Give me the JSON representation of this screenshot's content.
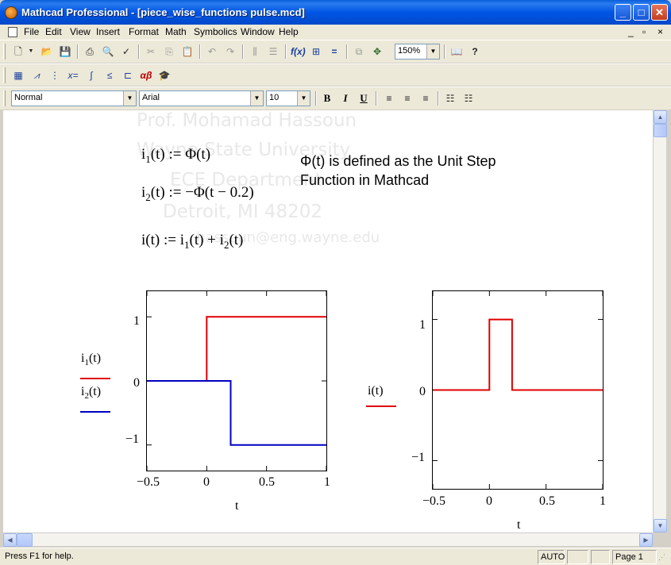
{
  "window": {
    "title": "Mathcad Professional - [piece_wise_functions pulse.mcd]",
    "controls": {
      "minimize": "_",
      "maximize": "□",
      "close": "✕"
    }
  },
  "menu": {
    "items": [
      "File",
      "Edit",
      "View",
      "Insert",
      "Format",
      "Math",
      "Symbolics",
      "Window",
      "Help"
    ],
    "doc_controls": [
      "_",
      "▫",
      "×"
    ]
  },
  "toolbar": {
    "zoom": "150%",
    "style": "Normal",
    "font": "Arial",
    "size": "10",
    "bold": "B",
    "italic": "I",
    "underline": "U"
  },
  "worksheet": {
    "watermark": [
      "Prof. Mohamad Hassoun",
      "Wayne State University",
      "ECE Department",
      "Detroit, MI 48202",
      "hassoun@eng.wayne.edu"
    ],
    "equations": {
      "eq1_lhs": "i",
      "eq1_sub": "1",
      "eq1_rhs": "(t) := Φ(t)",
      "eq2_lhs": "i",
      "eq2_sub": "2",
      "eq2_rhs": "(t) := −Φ(t − 0.2)",
      "eq3_a": "i(t) := i",
      "eq3_sub1": "1",
      "eq3_b": "(t) + i",
      "eq3_sub2": "2",
      "eq3_c": "(t)"
    },
    "note": {
      "line1": "Φ(t) is defined as the Unit Step",
      "line2": "Function in Mathcad"
    }
  },
  "chart_data": [
    {
      "type": "line",
      "xlabel": "t",
      "xlim": [
        -0.5,
        1
      ],
      "ylim": [
        -1.4,
        1.4
      ],
      "xticks": [
        "−0.5",
        "0",
        "0.5",
        "1"
      ],
      "yticks": [
        "1",
        "0",
        "−1"
      ],
      "legend": [
        {
          "name_base": "i",
          "name_sub": "1",
          "name_tail": "(t)"
        },
        {
          "name_base": "i",
          "name_sub": "2",
          "name_tail": "(t)"
        }
      ],
      "series": [
        {
          "color": "#e00000",
          "x": [
            -0.5,
            0,
            0,
            1
          ],
          "y": [
            0,
            0,
            1,
            1
          ]
        },
        {
          "color": "#0000c0",
          "x": [
            -0.5,
            0.2,
            0.2,
            1
          ],
          "y": [
            0,
            0,
            -1,
            -1
          ]
        }
      ]
    },
    {
      "type": "line",
      "xlabel": "t",
      "xlim": [
        -0.5,
        1
      ],
      "ylim": [
        -1.4,
        1.4
      ],
      "xticks": [
        "−0.5",
        "0",
        "0.5",
        "1"
      ],
      "yticks": [
        "1",
        "0",
        "−1"
      ],
      "legend": [
        {
          "name": "i(t)"
        }
      ],
      "series": [
        {
          "color": "#e00000",
          "x": [
            -0.5,
            0,
            0,
            0.2,
            0.2,
            1
          ],
          "y": [
            0,
            0,
            1,
            1,
            0,
            0
          ]
        }
      ]
    }
  ],
  "status": {
    "help": "Press F1 for help.",
    "mode": "AUTO",
    "page": "Page 1"
  }
}
